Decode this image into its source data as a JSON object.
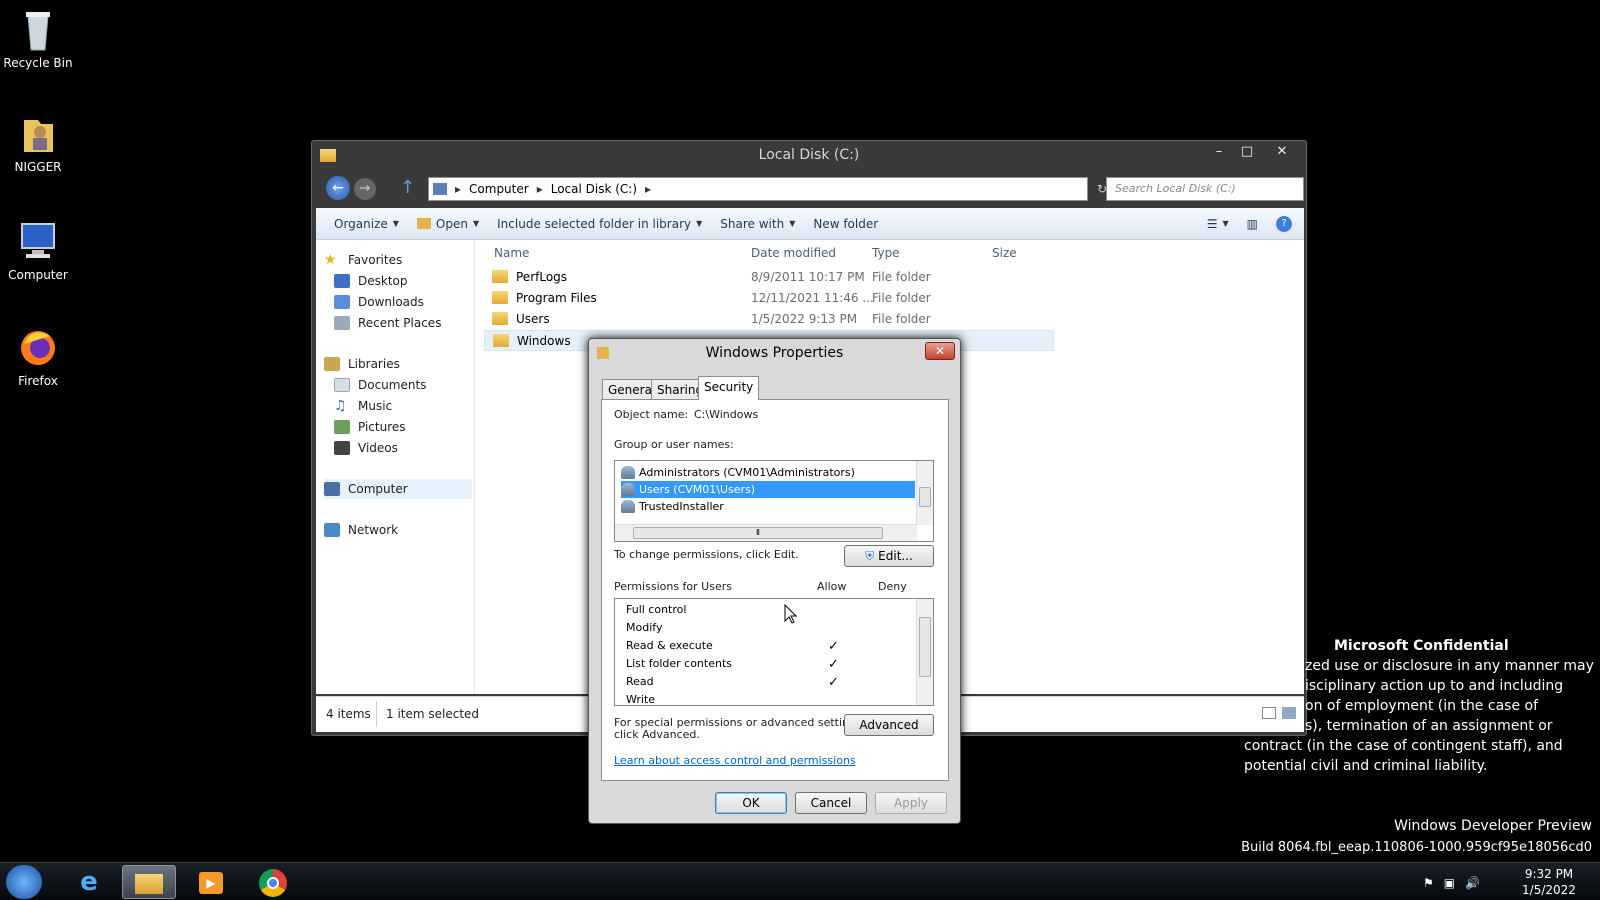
{
  "desktop": {
    "icons": [
      {
        "label": "Recycle Bin",
        "icon": "recycle-bin-icon"
      },
      {
        "label": "NIGGER",
        "icon": "user-folder-icon"
      },
      {
        "label": "Computer",
        "icon": "computer-icon"
      },
      {
        "label": "Firefox",
        "icon": "firefox-icon"
      }
    ]
  },
  "explorer": {
    "title": "Local Disk (C:)",
    "breadcrumb": [
      "Computer",
      "Local Disk (C:)"
    ],
    "search_placeholder": "Search Local Disk (C:)",
    "toolbar": {
      "organize": "Organize",
      "open": "Open",
      "include": "Include selected folder in library",
      "share": "Share with",
      "new_folder": "New folder"
    },
    "nav": {
      "favorites": "Favorites",
      "desktop": "Desktop",
      "downloads": "Downloads",
      "recent": "Recent Places",
      "libraries": "Libraries",
      "documents": "Documents",
      "music": "Music",
      "pictures": "Pictures",
      "videos": "Videos",
      "computer": "Computer",
      "network": "Network"
    },
    "columns": {
      "name": "Name",
      "date": "Date modified",
      "type": "Type",
      "size": "Size"
    },
    "files": [
      {
        "name": "PerfLogs",
        "date": "8/9/2011 10:17 PM",
        "type": "File folder"
      },
      {
        "name": "Program Files",
        "date": "12/11/2021 11:46 ...",
        "type": "File folder"
      },
      {
        "name": "Users",
        "date": "1/5/2022 9:13 PM",
        "type": "File folder"
      },
      {
        "name": "Windows",
        "date": "",
        "type": ""
      }
    ],
    "status": {
      "count": "4 items",
      "selected": "1 item selected"
    }
  },
  "dialog": {
    "title": "Windows Properties",
    "tabs": {
      "general": "General",
      "sharing": "Sharing",
      "security": "Security"
    },
    "object_label": "Object name:",
    "object_value": "C:\\Windows",
    "group_label": "Group or user names:",
    "groups": [
      "Administrators (CVM01\\Administrators)",
      "Users (CVM01\\Users)",
      "TrustedInstaller"
    ],
    "change_text": "To change permissions, click Edit.",
    "edit_button": "Edit...",
    "permissions_label": "Permissions for Users",
    "allow_label": "Allow",
    "deny_label": "Deny",
    "permissions": [
      {
        "name": "Full control",
        "allow": "",
        "deny": ""
      },
      {
        "name": "Modify",
        "allow": "",
        "deny": ""
      },
      {
        "name": "Read & execute",
        "allow": "✓",
        "deny": ""
      },
      {
        "name": "List folder contents",
        "allow": "✓",
        "deny": ""
      },
      {
        "name": "Read",
        "allow": "✓",
        "deny": ""
      },
      {
        "name": "Write",
        "allow": "",
        "deny": ""
      }
    ],
    "special_text_1": "For special permissions or advanced settings,",
    "special_text_2": "click Advanced.",
    "advanced_button": "Advanced",
    "learn_link": "Learn about access control and permissions",
    "ok": "OK",
    "cancel": "Cancel",
    "apply": "Apply"
  },
  "watermark": {
    "heading": "Microsoft Confidential",
    "lines": [
      "zed use or disclosure in any manner may",
      "isciplinary action up to and including",
      "on of employment (in the case of",
      "s), termination of an assignment or",
      "contract (in the case of contingent staff), and",
      "potential civil and criminal liability."
    ],
    "preview": "Windows Developer Preview",
    "build": "Build 8064.fbl_eeap.110806-1000.959cf95e18056cd0"
  },
  "taskbar": {
    "time": "9:32 PM",
    "date": "1/5/2022"
  }
}
